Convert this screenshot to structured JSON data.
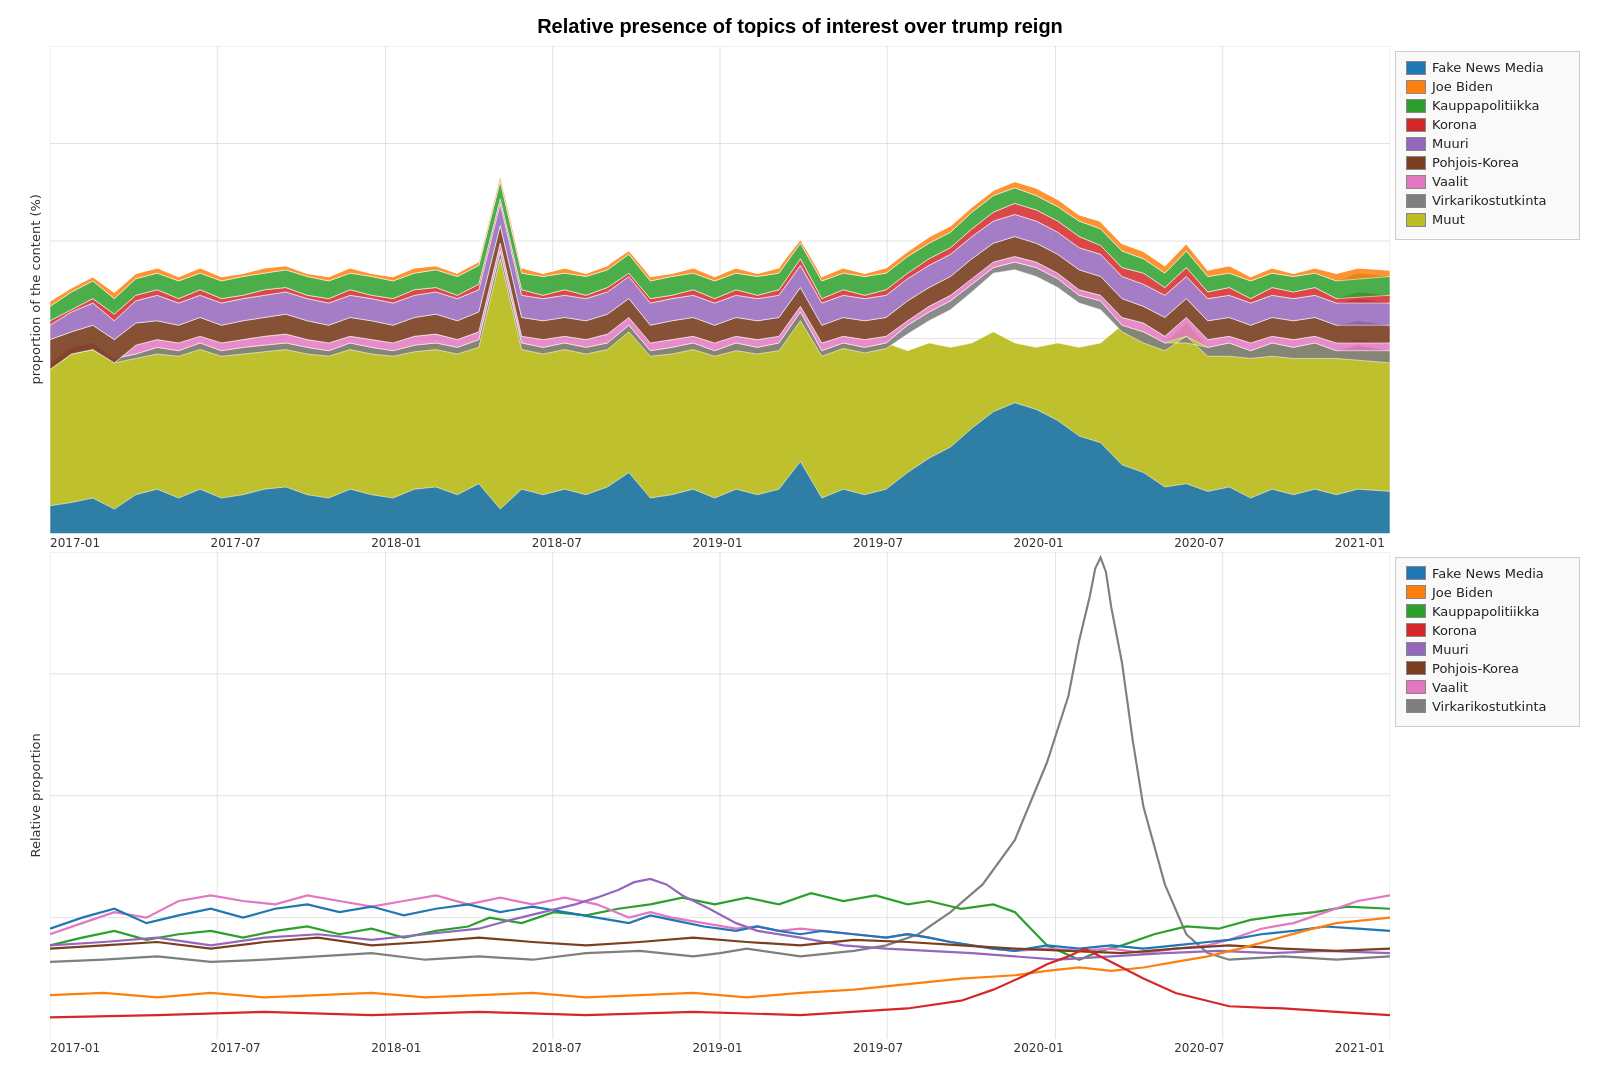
{
  "title": "Relative presence of topics of interest over trump reign",
  "xLabels": [
    "2017-01",
    "2017-07",
    "2018-01",
    "2018-07",
    "2019-01",
    "2019-07",
    "2020-01",
    "2020-07",
    "2021-01"
  ],
  "yLabel1": "proportion of the content (%)",
  "yLabel2": "Relative proportion",
  "legend1": [
    {
      "label": "Fake News Media",
      "color": "#1f77b4"
    },
    {
      "label": "Joe Biden",
      "color": "#ff7f0e"
    },
    {
      "label": "Kauppapolitiikka",
      "color": "#2ca02c"
    },
    {
      "label": "Korona",
      "color": "#d62728"
    },
    {
      "label": "Muuri",
      "color": "#9467bd"
    },
    {
      "label": "Pohjois-Korea",
      "color": "#7b3f20"
    },
    {
      "label": "Vaalit",
      "color": "#e377c2"
    },
    {
      "label": "Virkarikostutkinta",
      "color": "#7f7f7f"
    },
    {
      "label": "Muut",
      "color": "#bcbd22"
    }
  ],
  "legend2": [
    {
      "label": "Fake News Media",
      "color": "#1f77b4"
    },
    {
      "label": "Joe Biden",
      "color": "#ff7f0e"
    },
    {
      "label": "Kauppapolitiikka",
      "color": "#2ca02c"
    },
    {
      "label": "Korona",
      "color": "#d62728"
    },
    {
      "label": "Muuri",
      "color": "#9467bd"
    },
    {
      "label": "Pohjois-Korea",
      "color": "#7b3f20"
    },
    {
      "label": "Vaalit",
      "color": "#e377c2"
    },
    {
      "label": "Virkarikostutkinta",
      "color": "#7f7f7f"
    }
  ]
}
